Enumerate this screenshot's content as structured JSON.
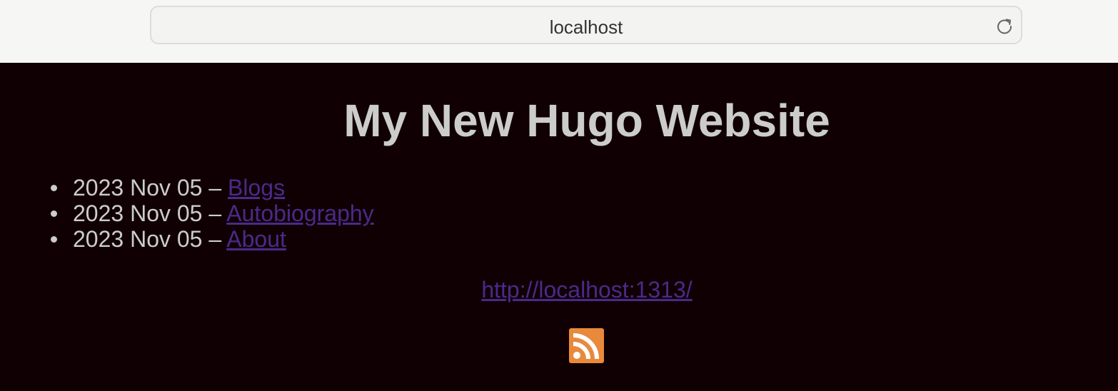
{
  "browser": {
    "address": "localhost",
    "reload_icon": "reload-icon"
  },
  "page": {
    "title": "My New Hugo Website",
    "posts": [
      {
        "date": "2023 Nov 05",
        "separator": " – ",
        "title": "Blogs"
      },
      {
        "date": "2023 Nov 05",
        "separator": " – ",
        "title": "Autobiography"
      },
      {
        "date": "2023 Nov 05",
        "separator": " – ",
        "title": "About"
      }
    ],
    "footer_link": "http://localhost:1313/",
    "rss_icon": "rss-icon"
  },
  "colors": {
    "background": "#100003",
    "text": "#cccccc",
    "link": "#4a2a8a",
    "rss": "#e8893c"
  }
}
